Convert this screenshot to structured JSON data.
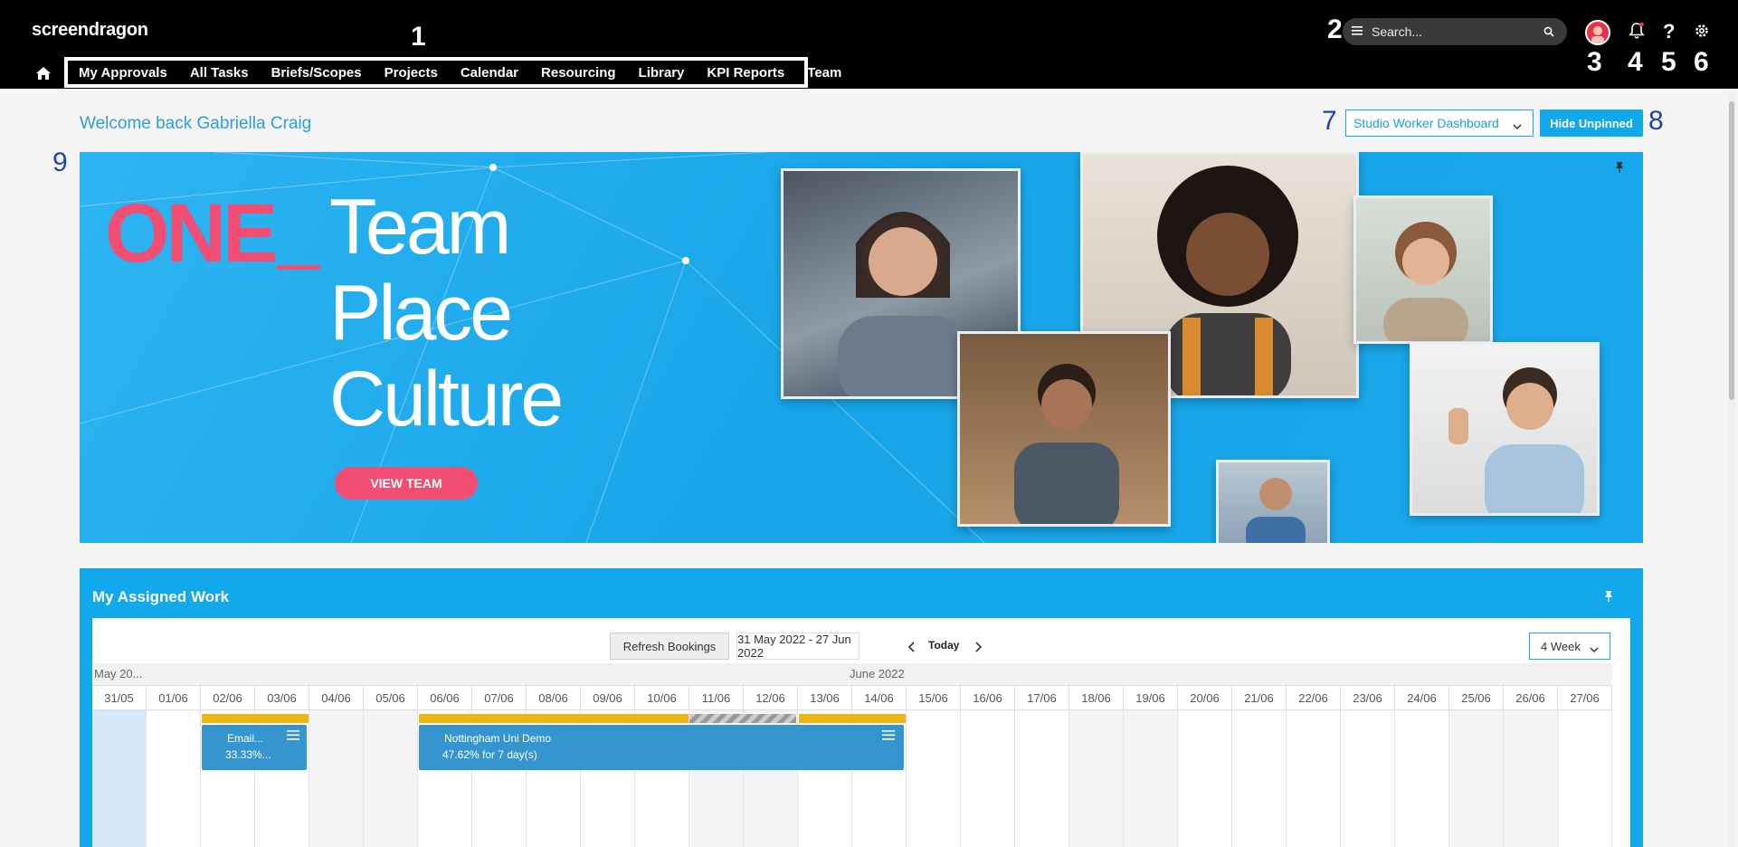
{
  "app": {
    "logo": "screendragon"
  },
  "nav": {
    "items": [
      "My Approvals",
      "All Tasks",
      "Briefs/Scopes",
      "Projects",
      "Calendar",
      "Resourcing",
      "Library",
      "KPI Reports",
      "Team"
    ]
  },
  "search": {
    "placeholder": "Search..."
  },
  "annotations": [
    "1",
    "2",
    "3",
    "4",
    "5",
    "6",
    "7",
    "8",
    "9"
  ],
  "welcome": "Welcome back Gabriella Craig",
  "dashboard": {
    "selected": "Studio Worker Dashboard",
    "hide_label": "Hide Unpinned"
  },
  "banner": {
    "brand": "ONE",
    "lines": [
      "Team",
      "Place",
      "Culture"
    ],
    "cta": "VIEW TEAM"
  },
  "assigned": {
    "title": "My Assigned Work",
    "refresh_label": "Refresh Bookings",
    "date_range": "31 May 2022 - 27 Jun 2022",
    "today_label": "Today",
    "view_select": "4 Week",
    "months": [
      "May 20...",
      "June 2022"
    ],
    "days": [
      "31/05",
      "01/06",
      "02/06",
      "03/06",
      "04/06",
      "05/06",
      "06/06",
      "07/06",
      "08/06",
      "09/06",
      "10/06",
      "11/06",
      "12/06",
      "13/06",
      "14/06",
      "15/06",
      "16/06",
      "17/06",
      "18/06",
      "19/06",
      "20/06",
      "21/06",
      "22/06",
      "23/06",
      "24/06",
      "25/06",
      "26/06",
      "27/06"
    ],
    "bookings": [
      {
        "name": "Email...",
        "detail": "33.33%..."
      },
      {
        "name": "Nottingham Uni Demo",
        "detail": "47.62% for 7 day(s)"
      }
    ]
  },
  "colors": {
    "accent": "#11a8ec",
    "brand_pink": "#f24d72",
    "booking": "#3596cf",
    "allocation": "#f0b412"
  }
}
